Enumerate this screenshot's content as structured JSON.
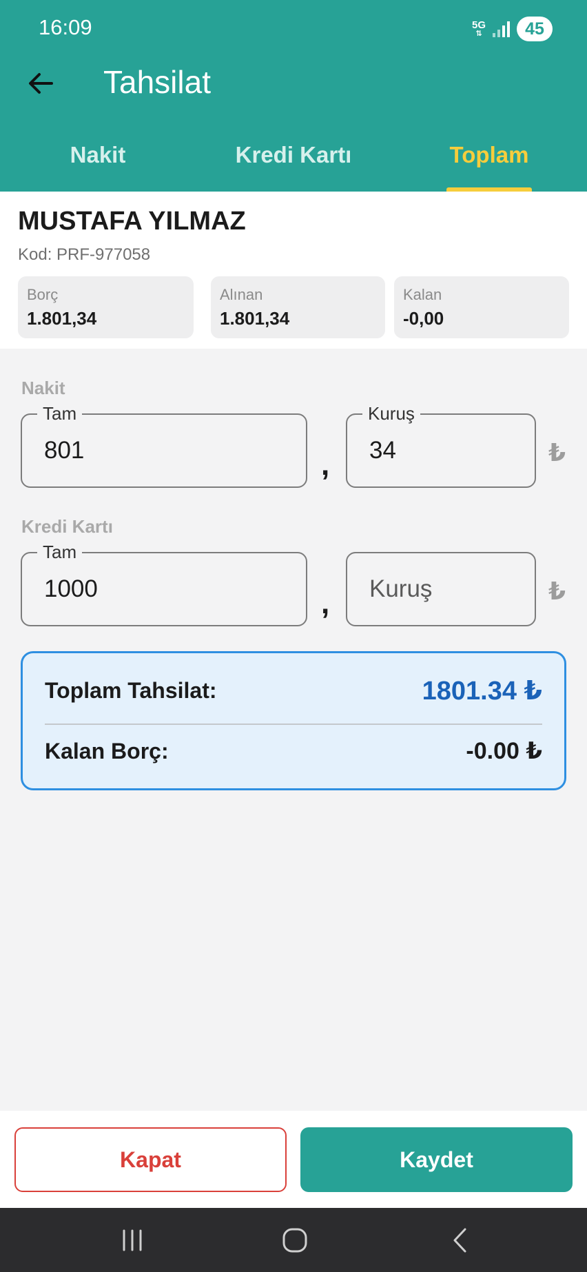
{
  "status_bar": {
    "time": "16:09",
    "network_label": "5G",
    "battery": "45"
  },
  "header": {
    "title": "Tahsilat",
    "back_icon": "arrow-left-icon"
  },
  "tabs": [
    {
      "label": "Nakit",
      "active": false
    },
    {
      "label": "Kredi Kartı",
      "active": false
    },
    {
      "label": "Toplam",
      "active": true
    }
  ],
  "customer": {
    "name": "MUSTAFA YILMAZ",
    "code": "Kod: PRF-977058",
    "summary": [
      {
        "label": "Borç",
        "value": "1.801,34"
      },
      {
        "label": "Alınan",
        "value": "1.801,34"
      },
      {
        "label": "Kalan",
        "value": "-0,00"
      }
    ]
  },
  "form": {
    "cash": {
      "section_label": "Nakit",
      "whole_label": "Tam",
      "whole_value": "801",
      "cents_label": "Kuruş",
      "cents_value": "34",
      "separator": ",",
      "currency_symbol": "₺"
    },
    "card": {
      "section_label": "Kredi Kartı",
      "whole_label": "Tam",
      "whole_value": "1000",
      "cents_placeholder": "Kuruş",
      "separator": ",",
      "currency_symbol": "₺"
    }
  },
  "totals": {
    "total_label": "Toplam Tahsilat:",
    "total_value": "1801.34 ₺",
    "remaining_label": "Kalan Borç:",
    "remaining_value": "-0.00 ₺",
    "accent_color": "#1a62b8"
  },
  "actions": {
    "close_label": "Kapat",
    "save_label": "Kaydet"
  },
  "colors": {
    "primary": "#27a296",
    "tab_active": "#f6cd3c",
    "danger": "#d9403a",
    "totals_border": "#2e8fe1"
  }
}
